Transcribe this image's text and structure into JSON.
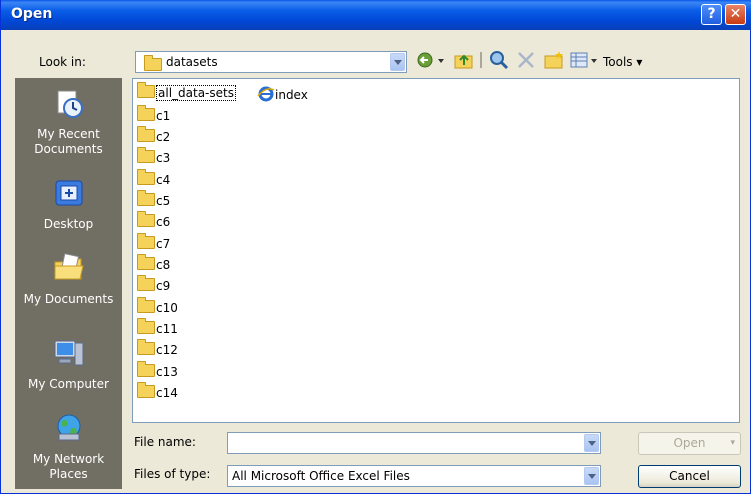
{
  "window": {
    "title": "Open"
  },
  "look_in": {
    "label": "Look in:",
    "value": "datasets"
  },
  "toolbar": {
    "back_icon": "back-icon",
    "up_icon": "up-folder-icon",
    "search_icon": "search-web-icon",
    "delete_icon": "delete-icon",
    "new_folder_icon": "new-folder-icon",
    "views_icon": "views-icon",
    "tools_label": "Tools"
  },
  "places": [
    {
      "label": "My Recent Documents",
      "icon": "recent-documents-icon"
    },
    {
      "label": "Desktop",
      "icon": "desktop-icon"
    },
    {
      "label": "My Documents",
      "icon": "my-documents-icon"
    },
    {
      "label": "My Computer",
      "icon": "my-computer-icon"
    },
    {
      "label": "My Network Places",
      "icon": "network-places-icon"
    }
  ],
  "files": {
    "column1": [
      "all_data-sets",
      "c1",
      "c2",
      "c3",
      "c4",
      "c5",
      "c6",
      "c7",
      "c8",
      "c9",
      "c10",
      "c11",
      "c12",
      "c13",
      "c14"
    ],
    "column2": [
      {
        "name": "index",
        "icon": "ie-document-icon"
      }
    ]
  },
  "file_name": {
    "label": "File name:",
    "value": ""
  },
  "file_type": {
    "label": "Files of type:",
    "value": "All Microsoft Office Excel Files"
  },
  "buttons": {
    "open": "Open",
    "cancel": "Cancel"
  },
  "colors": {
    "titlebar": "#0a5de8",
    "places_bar": "#716f64",
    "dialog_bg": "#ece9d8"
  }
}
